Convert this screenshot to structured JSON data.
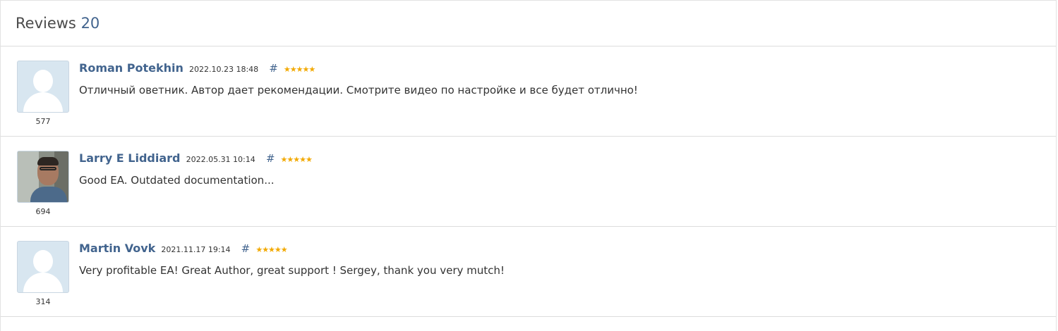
{
  "header": {
    "title": "Reviews",
    "count": "20"
  },
  "reviews": [
    {
      "author": "Roman Potekhin",
      "date": "2022.10.23 18:48",
      "hash": "#",
      "stars": "★★★★★",
      "rating_value": 5,
      "user_rating": "577",
      "avatar": "default-avatar",
      "text": "Отличный оветник. Автор дает рекомендации. Смотрите видео по настройке и все будет отлично!"
    },
    {
      "author": "Larry E Liddiard",
      "date": "2022.05.31 10:14",
      "hash": "#",
      "stars": "★★★★★",
      "rating_value": 5,
      "user_rating": "694",
      "avatar": "photo-avatar",
      "text": "Good EA. Outdated documentation..."
    },
    {
      "author": "Martin Vovk",
      "date": "2021.11.17 19:14",
      "hash": "#",
      "stars": "★★★★★",
      "rating_value": 5,
      "user_rating": "314",
      "avatar": "default-avatar",
      "text": "Very profitable EA! Great Author, great support ! Sergey, thank you very mutch!"
    }
  ],
  "colors": {
    "link": "#42648e",
    "star": "#f2a900",
    "border": "#dddddd"
  }
}
